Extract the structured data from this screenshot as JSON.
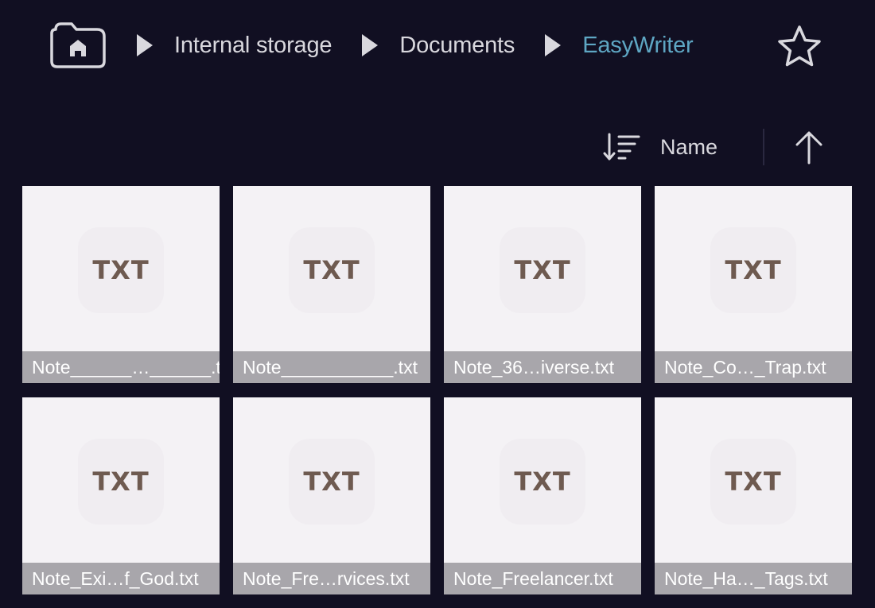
{
  "breadcrumb": {
    "home_icon": "home-folder-icon",
    "separator_icon": "play-triangle-icon",
    "items": [
      {
        "label": "Internal storage"
      },
      {
        "label": "Documents"
      },
      {
        "label": "EasyWriter"
      }
    ],
    "current_color": "#5ea6c3"
  },
  "favorite_icon": "star-outline-icon",
  "sort": {
    "icon": "sort-lines-icon",
    "label": "Name",
    "direction_icon": "arrow-up-icon"
  },
  "file_type_badge": "TXT",
  "files": [
    {
      "name": "Note______…______.txt"
    },
    {
      "name": "Note___________.txt"
    },
    {
      "name": "Note_36…iverse.txt"
    },
    {
      "name": "Note_Co…_Trap.txt"
    },
    {
      "name": "Note_Exi…f_God.txt"
    },
    {
      "name": "Note_Fre…rvices.txt"
    },
    {
      "name": "Note_Freelancer.txt"
    },
    {
      "name": "Note_Ha…_Tags.txt"
    }
  ],
  "colors": {
    "background": "#110f22",
    "tile": "#f4f2f5",
    "label_band": "#a8a6ab",
    "txt_text": "#6e5a50"
  }
}
